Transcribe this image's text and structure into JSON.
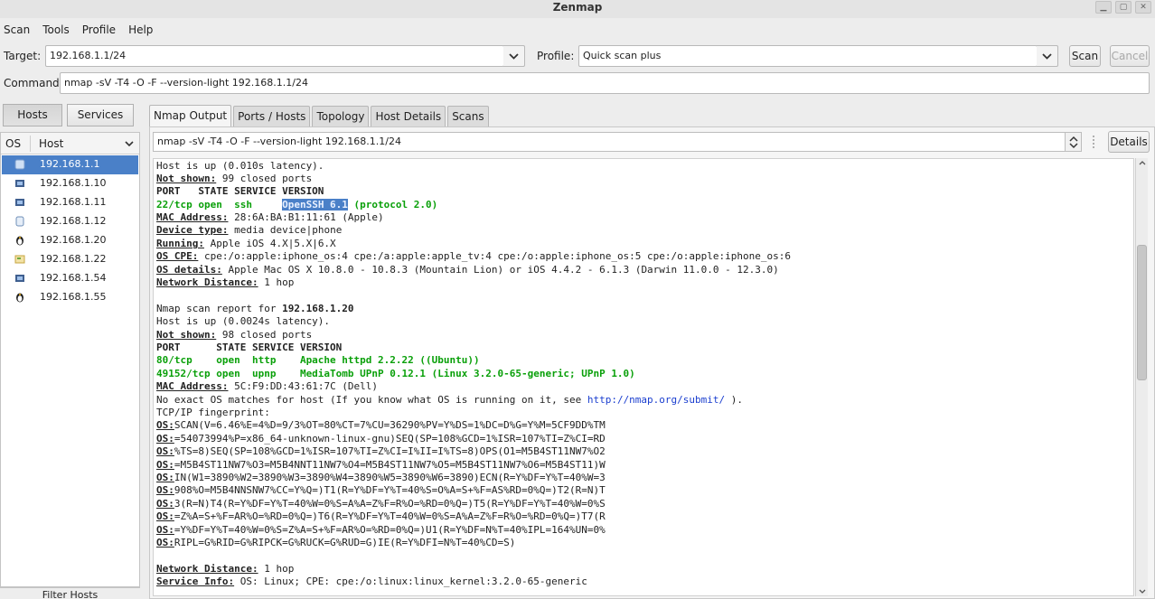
{
  "window": {
    "title": "Zenmap"
  },
  "menu": [
    "Scan",
    "Tools",
    "Profile",
    "Help"
  ],
  "target": {
    "label": "Target:",
    "value": "192.168.1.1/24"
  },
  "profile": {
    "label": "Profile:",
    "value": "Quick scan plus"
  },
  "buttons": {
    "scan": "Scan",
    "cancel": "Cancel",
    "details": "Details",
    "filter": "Filter Hosts"
  },
  "command": {
    "label": "Command:",
    "value": "nmap -sV -T4 -O -F --version-light 192.168.1.1/24"
  },
  "view_toggle": {
    "hosts": "Hosts",
    "services": "Services"
  },
  "host_list": {
    "col_os": "OS",
    "col_host": "Host",
    "hosts": [
      {
        "ip": "192.168.1.1",
        "os_icon": "apple-icon",
        "selected": true
      },
      {
        "ip": "192.168.1.10",
        "os_icon": "windows-icon"
      },
      {
        "ip": "192.168.1.11",
        "os_icon": "windows-icon"
      },
      {
        "ip": "192.168.1.12",
        "os_icon": "apple-icon"
      },
      {
        "ip": "192.168.1.20",
        "os_icon": "linux-penguin-icon"
      },
      {
        "ip": "192.168.1.22",
        "os_icon": "unknown-os-icon"
      },
      {
        "ip": "192.168.1.54",
        "os_icon": "windows-icon"
      },
      {
        "ip": "192.168.1.55",
        "os_icon": "linux-penguin-icon"
      }
    ]
  },
  "tabs": [
    "Nmap Output",
    "Ports / Hosts",
    "Topology",
    "Host Details",
    "Scans"
  ],
  "output": {
    "selected_command": "nmap -sV -T4 -O -F --version-light 192.168.1.1/24",
    "host1": {
      "up": "Host is up (0.010s latency).",
      "ns_label": "Not shown:",
      "ns_value": " 99 closed ports",
      "port_header": "PORT   STATE SERVICE VERSION",
      "port_line_a": "22/tcp open  ssh     ",
      "port_line_hl": "OpenSSH 6.1",
      "port_line_b": " (protocol 2.0)",
      "mac_label": "MAC Address:",
      "mac_value": " 28:6A:BA:B1:11:61 (Apple)",
      "dev_label": "Device type:",
      "dev_value": " media device|phone",
      "run_label": "Running:",
      "run_value": " Apple iOS 4.X|5.X|6.X",
      "cpe_label": "OS CPE:",
      "cpe_value": " cpe:/o:apple:iphone_os:4 cpe:/a:apple:apple_tv:4 cpe:/o:apple:iphone_os:5 cpe:/o:apple:iphone_os:6",
      "det_label": "OS details:",
      "det_value": " Apple Mac OS X 10.8.0 - 10.8.3 (Mountain Lion) or iOS 4.4.2 - 6.1.3 (Darwin 11.0.0 - 12.3.0)",
      "dist_label": "Network Distance:",
      "dist_value": " 1 hop"
    },
    "host2": {
      "report_prefix": "Nmap scan report for ",
      "report_ip": "192.168.1.20",
      "up": "Host is up (0.0024s latency).",
      "ns_label": "Not shown:",
      "ns_value": " 98 closed ports",
      "port_header": "PORT      STATE SERVICE VERSION",
      "port_line1": "80/tcp    open  http    Apache httpd 2.2.22 ((Ubuntu))",
      "port_line2": "49152/tcp open  upnp    MediaTomb UPnP 0.12.1 (Linux 3.2.0-65-generic; UPnP 1.0)",
      "mac_label": "MAC Address:",
      "mac_value": " 5C:F9:DD:43:61:7C (Dell)",
      "nomatch_prefix": "No exact OS matches for host (If you know what OS is running on it, see ",
      "nomatch_link": "http://nmap.org/submit/",
      "nomatch_suffix": " ).",
      "fp_header": "TCP/IP fingerprint:",
      "os_label": "OS:",
      "fp_lines": [
        "SCAN(V=6.46%E=4%D=9/3%OT=80%CT=7%CU=36290%PV=Y%DS=1%DC=D%G=Y%M=5CF9DD%TM",
        "=54073994%P=x86_64-unknown-linux-gnu)SEQ(SP=108%GCD=1%ISR=107%TI=Z%CI=RD",
        "%TS=8)SEQ(SP=108%GCD=1%ISR=107%TI=Z%CI=I%II=I%TS=8)OPS(O1=M5B4ST11NW7%O2",
        "=M5B4ST11NW7%O3=M5B4NNT11NW7%O4=M5B4ST11NW7%O5=M5B4ST11NW7%O6=M5B4ST11)W",
        "IN(W1=3890%W2=3890%W3=3890%W4=3890%W5=3890%W6=3890)ECN(R=Y%DF=Y%T=40%W=3",
        "908%O=M5B4NNSNW7%CC=Y%Q=)T1(R=Y%DF=Y%T=40%S=O%A=S+%F=AS%RD=0%Q=)T2(R=N)T",
        "3(R=N)T4(R=Y%DF=Y%T=40%W=0%S=A%A=Z%F=R%O=%RD=0%Q=)T5(R=Y%DF=Y%T=40%W=0%S",
        "=Z%A=S+%F=AR%O=%RD=0%Q=)T6(R=Y%DF=Y%T=40%W=0%S=A%A=Z%F=R%O=%RD=0%Q=)T7(R",
        "=Y%DF=Y%T=40%W=0%S=Z%A=S+%F=AR%O=%RD=0%Q=)U1(R=Y%DF=N%T=40%IPL=164%UN=0%",
        "RIPL=G%RID=G%RIPCK=G%RUCK=G%RUD=G)IE(R=Y%DFI=N%T=40%CD=S)"
      ],
      "dist_label": "Network Distance:",
      "dist_value": " 1 hop",
      "svc_label": "Service Info:",
      "svc_value": " OS: Linux; CPE: cpe:/o:linux:linux_kernel:3.2.0-65-generic"
    }
  }
}
